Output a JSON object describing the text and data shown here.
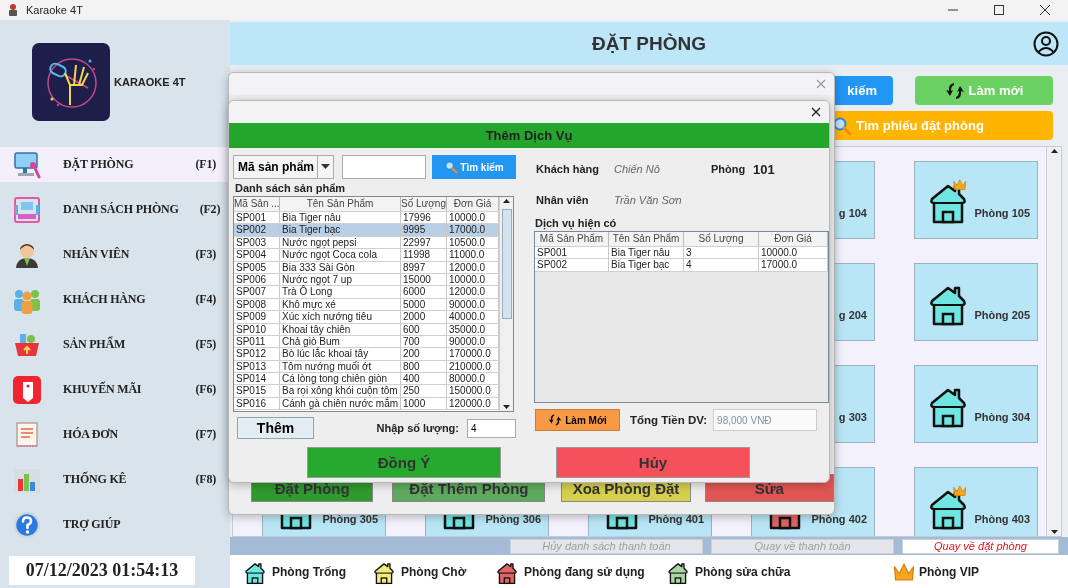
{
  "window": {
    "title": "Karaoke 4T"
  },
  "sidebar": {
    "brand": "KARAOKE 4T",
    "items": [
      {
        "label": "ĐẶT PHÒNG",
        "shortcut": "(F1)",
        "selected": true
      },
      {
        "label": "DANH SÁCH PHÒNG",
        "shortcut": "(F2)",
        "selected": false
      },
      {
        "label": "NHÂN VIÊN",
        "shortcut": "(F3)",
        "selected": false
      },
      {
        "label": "KHÁCH HÀNG",
        "shortcut": "(F4)",
        "selected": false
      },
      {
        "label": "SẢN PHẨM",
        "shortcut": "(F5)",
        "selected": false
      },
      {
        "label": "KHUYẾN MÃI",
        "shortcut": "(F6)",
        "selected": false
      },
      {
        "label": "HÓA ĐƠN",
        "shortcut": "(F7)",
        "selected": false
      },
      {
        "label": "THỐNG KÊ",
        "shortcut": "(F8)",
        "selected": false
      },
      {
        "label": "TRỢ GIÚP",
        "selected": false
      }
    ],
    "clock": "07/12/2023 01:54:13"
  },
  "header": {
    "title": "ĐẶT PHÒNG"
  },
  "toolbar": {
    "search_button": "kiếm",
    "refresh_button": "Làm mới",
    "find_booking_button": "Tìm phiếu đặt phòng"
  },
  "room_grid": {
    "rows": [
      {
        "rooms": [
          {
            "label": "g 104"
          },
          {
            "label": "Phòng 105",
            "kind": "empty",
            "vip": true
          }
        ]
      },
      {
        "rooms": [
          {
            "label": "g 204"
          },
          {
            "label": "Phòng 205",
            "kind": "empty",
            "vip": false
          }
        ]
      },
      {
        "rooms": [
          {
            "label": "g 303"
          },
          {
            "label": "Phòng 304",
            "kind": "empty",
            "vip": false
          }
        ]
      },
      {
        "rooms": [
          {
            "label": "Phòng 305",
            "kind": "empty"
          },
          {
            "label": "Phòng 306",
            "kind": "empty"
          },
          {
            "label": "Phòng 401",
            "kind": "empty"
          },
          {
            "label": "Phòng 402",
            "kind": "in_use"
          },
          {
            "label": "Phòng 403",
            "kind": "empty",
            "vip": true
          }
        ]
      }
    ]
  },
  "booking_dialog": {
    "buttons": [
      {
        "label": "Đặt Phòng",
        "kind": "book"
      },
      {
        "label": "Đặt Thêm Phòng",
        "kind": "add"
      },
      {
        "label": "Xoa Phòng Đặt",
        "kind": "remove"
      },
      {
        "label": "Sửa",
        "kind": "edit"
      }
    ]
  },
  "service_dialog": {
    "title": "Thêm Dịch Vụ",
    "search": {
      "filter": "Mã sản phẩm",
      "button": "Tìm kiếm"
    },
    "product_list": {
      "title": "Danh sách sản phẩm",
      "columns": [
        "Mã Sản ...",
        "Tên Sản Phẩm",
        "Số Lượng",
        "Đơn Giá"
      ],
      "rows": [
        {
          "cells": [
            "SP001",
            "Bia Tiger nâu",
            "17996",
            "10000.0"
          ],
          "selected": false
        },
        {
          "cells": [
            "SP002",
            "Bia Tiger bạc",
            "9995",
            "17000.0"
          ],
          "selected": true
        },
        {
          "cells": [
            "SP003",
            "Nước ngọt pepsi",
            "22997",
            "10500.0"
          ],
          "selected": false
        },
        {
          "cells": [
            "SP004",
            "Nước ngọt Coca cola",
            "11998",
            "11000.0"
          ],
          "selected": false
        },
        {
          "cells": [
            "SP005",
            "Bia 333 Sài Gòn",
            "8997",
            "12000.0"
          ],
          "selected": false
        },
        {
          "cells": [
            "SP006",
            "Nước ngọt 7 up",
            "15000",
            "10000.0"
          ],
          "selected": false
        },
        {
          "cells": [
            "SP007",
            "Trà Ô Long",
            "6000",
            "12000.0"
          ],
          "selected": false
        },
        {
          "cells": [
            "SP008",
            "Khô mực xé",
            "5000",
            "90000.0"
          ],
          "selected": false
        },
        {
          "cells": [
            "SP009",
            "Xúc xích nướng tiêu",
            "2000",
            "40000.0"
          ],
          "selected": false
        },
        {
          "cells": [
            "SP010",
            "Khoai tây chiên",
            "600",
            "35000.0"
          ],
          "selected": false
        },
        {
          "cells": [
            "SP011",
            "Chả giò Bum",
            "700",
            "90000.0"
          ],
          "selected": false
        },
        {
          "cells": [
            "SP012",
            "Bò lúc lắc khoai tây",
            "200",
            "170000.0"
          ],
          "selected": false
        },
        {
          "cells": [
            "SP013",
            "Tôm nướng muối ớt",
            "800",
            "210000.0"
          ],
          "selected": false
        },
        {
          "cells": [
            "SP014",
            "Cá lòng tong chiên giòn",
            "400",
            "80000.0"
          ],
          "selected": false
        },
        {
          "cells": [
            "SP015",
            "Ba rọi xông khói cuộn tôm",
            "250",
            "150000.0"
          ],
          "selected": false
        },
        {
          "cells": [
            "SP016",
            "Cánh gà chiên nước mắm",
            "1000",
            "120000.0"
          ],
          "selected": false
        }
      ]
    },
    "add_button": "Thêm",
    "quantity": {
      "label": "Nhập số lượng:",
      "value": "4"
    },
    "customer": {
      "label": "Khách hàng",
      "value": "Chiến Nô"
    },
    "room": {
      "label": "Phòng",
      "value": "101"
    },
    "staff": {
      "label": "Nhân viên",
      "value": "Trần Văn Sơn"
    },
    "current_services": {
      "title": "Dịch vụ hiện có",
      "columns": [
        "Mã Sản Phẩm",
        "Tên Sản Phẩm",
        "Số Lượng",
        "Đơn Giá"
      ],
      "rows": [
        {
          "cells": [
            "SP001",
            "Bia Tiger nâu",
            "3",
            "10000.0"
          ],
          "selected": false
        },
        {
          "cells": [
            "SP002",
            "Bia Tiger bạc",
            "4",
            "17000.0"
          ],
          "selected": false
        }
      ]
    },
    "refresh_button": "Làm Mới",
    "total": {
      "label": "Tổng Tiền DV:",
      "value": "98,000 VNĐ",
      "disabled": true
    },
    "confirm_button": "Đồng Ý",
    "cancel_button": "Hủy"
  },
  "bottom_bar": {
    "buttons": [
      {
        "label": "Hủy danh sách thanh toán",
        "disabled": true
      },
      {
        "label": "Quay về thanh toán",
        "disabled": true
      },
      {
        "label": "Quay về đặt phòng",
        "disabled": false
      }
    ]
  },
  "legend": [
    {
      "label": "Phòng Trống",
      "kind": "empty"
    },
    {
      "label": "Phòng Chờ",
      "kind": "waiting"
    },
    {
      "label": "Phòng đang sử dụng",
      "kind": "in_use"
    },
    {
      "label": "Phòng sửa chữa",
      "kind": "repair"
    },
    {
      "label": "Phòng VIP",
      "kind": "vip"
    }
  ]
}
